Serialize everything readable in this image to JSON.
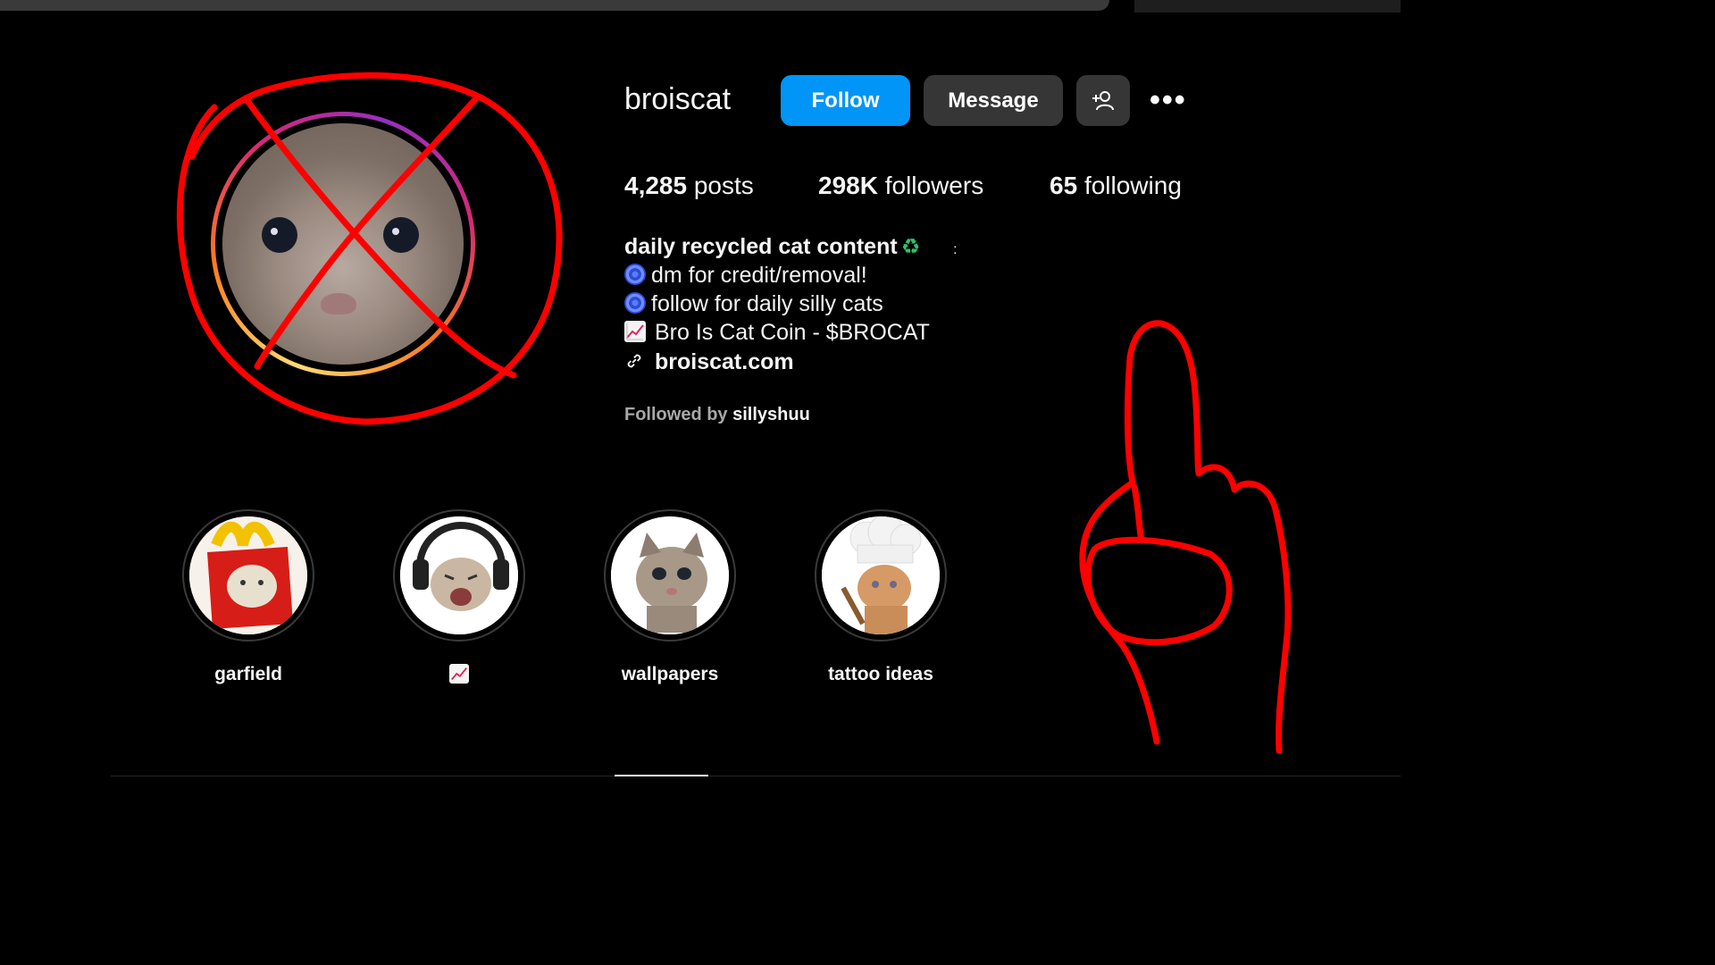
{
  "profile": {
    "username": "broiscat",
    "follow_label": "Follow",
    "message_label": "Message",
    "more_label": "•••",
    "stats": {
      "posts_count": "4,285",
      "posts_label": "posts",
      "followers_count": "298K",
      "followers_label": "followers",
      "following_count": "65",
      "following_label": "following"
    },
    "bio": {
      "name": "daily recycled cat content",
      "line1": "dm for credit/removal!",
      "line2": "follow for daily silly cats",
      "line3": "Bro Is Cat Coin - $BROCAT",
      "link": "broiscat.com"
    },
    "followed_by_prefix": "Followed by",
    "followed_by_user": "sillyshuu"
  },
  "highlights": [
    {
      "label": "garfield"
    },
    {
      "label": ""
    },
    {
      "label": "wallpapers"
    },
    {
      "label": "tattoo ideas"
    }
  ],
  "colors": {
    "follow_button": "#0095f6",
    "secondary_button": "#363636",
    "background": "#000000",
    "annotation_red": "#ff0000"
  }
}
